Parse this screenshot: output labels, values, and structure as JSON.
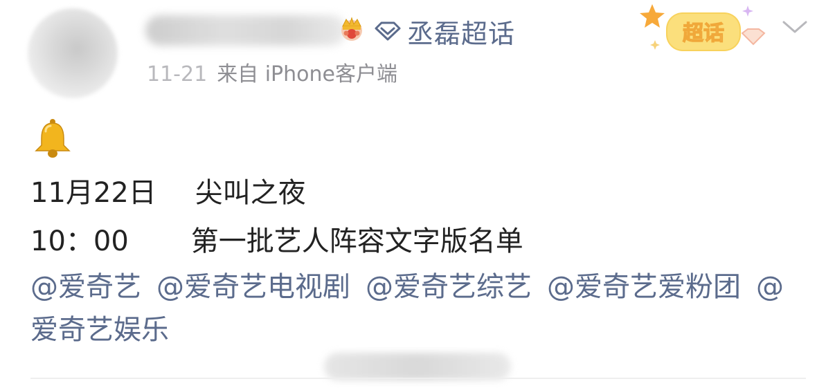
{
  "post": {
    "supertopic": "丞磊超话",
    "badge_label": "超话",
    "meta": {
      "time": "11-21",
      "source": "来自 iPhone客户端"
    },
    "content": {
      "line1_date": "11月22日",
      "line1_event": "尖叫之夜",
      "line2_time": "10：00",
      "line2_text": "第一批艺人阵容文字版名单"
    },
    "mentions": [
      "@爱奇艺",
      "@爱奇艺电视剧",
      "@爱奇艺综艺",
      "@爱奇艺爱粉团",
      "@爱奇艺娱乐"
    ]
  },
  "icons": {
    "crown": "crown-icon",
    "supertopic": "diamond-icon",
    "menu": "chevron-down-icon",
    "bell": "bell-icon"
  },
  "colors": {
    "link": "#5b6b8c",
    "text": "#222222",
    "meta": "#8e8e93",
    "badge": "#f5c542"
  }
}
